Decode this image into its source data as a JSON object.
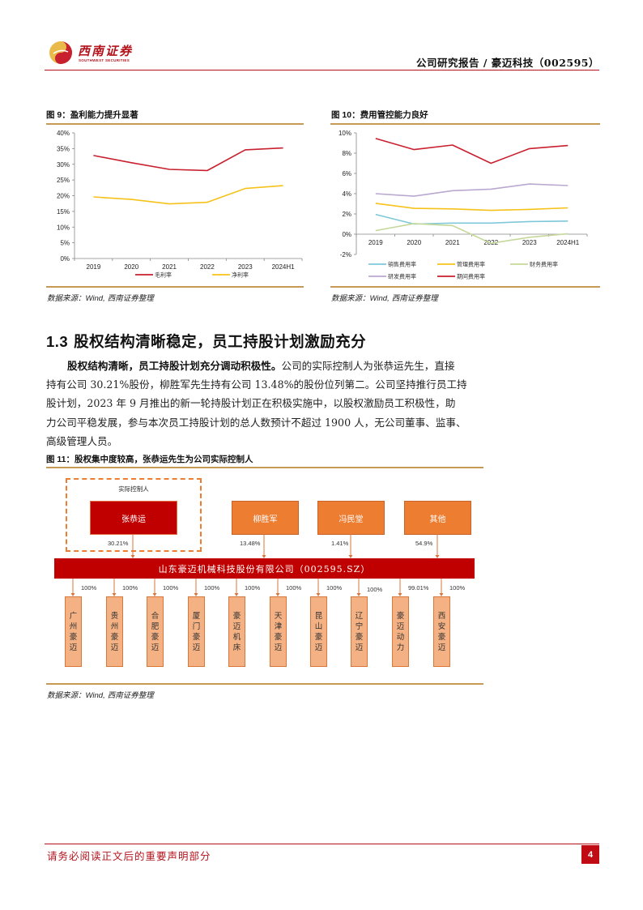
{
  "header": {
    "logo_cn": "西南证券",
    "logo_en": "SOUTHWEST SECURITIES",
    "title": "公司研究报告 / 豪迈科技（002595）",
    "brand_color": "#b3121b"
  },
  "figures": {
    "fig9": {
      "label": "图 9：",
      "title": "盈利能力提升显著",
      "source_prefix": "数据来源：",
      "source_en": "Wind,",
      "source_cn": " 西南证券整理"
    },
    "fig10": {
      "label": "图 10：",
      "title": "费用管控能力良好",
      "source_prefix": "数据来源：",
      "source_en": "Wind,",
      "source_cn": " 西南证券整理"
    },
    "fig11": {
      "label": "图 11：",
      "title": "股权集中度较高，张恭运先生为公司实际控制人",
      "source_prefix": "数据来源：",
      "source_en": "Wind,",
      "source_cn": " 西南证券整理"
    }
  },
  "chart_data": [
    {
      "id": "fig9",
      "type": "line",
      "title": "盈利能力提升显著",
      "categories": [
        "2019",
        "2020",
        "2021",
        "2022",
        "2023",
        "2024H1"
      ],
      "ylim": [
        0,
        40
      ],
      "yticks": [
        0,
        5,
        10,
        15,
        20,
        25,
        30,
        35,
        40
      ],
      "ytick_labels": [
        "0%",
        "5%",
        "10%",
        "15%",
        "20%",
        "25%",
        "30%",
        "35%",
        "40%"
      ],
      "grid": false,
      "legend": "bottom",
      "series": [
        {
          "name": "毛利率",
          "color": "#c8202e",
          "values": [
            32.8,
            30.5,
            28.4,
            28.0,
            34.6,
            35.2
          ]
        },
        {
          "name": "净利率",
          "color": "#f6c21a",
          "values": [
            19.6,
            18.8,
            17.4,
            17.9,
            22.3,
            23.2
          ]
        }
      ]
    },
    {
      "id": "fig10",
      "type": "line",
      "title": "费用管控能力良好",
      "categories": [
        "2019",
        "2020",
        "2021",
        "2022",
        "2023",
        "2024H1"
      ],
      "ylim": [
        -2,
        10
      ],
      "yticks": [
        -2,
        0,
        2,
        4,
        6,
        8,
        10
      ],
      "ytick_labels": [
        "-2%",
        "0%",
        "2%",
        "4%",
        "6%",
        "8%",
        "10%"
      ],
      "grid": false,
      "legend": "bottom",
      "series": [
        {
          "name": "销售费用率",
          "color": "#7fc8d8",
          "values": [
            1.95,
            1.0,
            1.1,
            1.1,
            1.25,
            1.3
          ]
        },
        {
          "name": "管理费用率",
          "color": "#f6c21a",
          "values": [
            3.05,
            2.55,
            2.5,
            2.35,
            2.45,
            2.6
          ]
        },
        {
          "name": "财务费用率",
          "color": "#c5d89a",
          "values": [
            0.35,
            1.05,
            0.85,
            -0.9,
            -0.3,
            0.05
          ]
        },
        {
          "name": "研发费用率",
          "color": "#b9a8d0",
          "values": [
            4.0,
            3.75,
            4.3,
            4.45,
            4.95,
            4.8
          ]
        },
        {
          "name": "期间费用率",
          "color": "#c8202e",
          "values": [
            9.45,
            8.35,
            8.8,
            7.0,
            8.45,
            8.75
          ]
        }
      ]
    }
  ],
  "section": {
    "number": "1.3",
    "title": " 股权结构清晰稳定，员工持股计划激励充分"
  },
  "paragraph": {
    "lines": [
      {
        "lead": "股权结构清晰，员工持股计划充分调动积极性。",
        "text": "公司的实际控制人为张恭运先生，直接"
      },
      {
        "lead": "",
        "text": "持有公司 30.21%股份，柳胜军先生持有公司 13.48%的股份位列第二。公司坚持推行员工持"
      },
      {
        "lead": "",
        "text": "股计划，2023 年 9 月推出的新一轮持股计划正在积极实施中，以股权激励员工积极性，助"
      },
      {
        "lead": "",
        "text": "力公司平稳发展，参与本次员工持股计划的总人数预计不超过 1900 人，无公司董事、监事、"
      },
      {
        "lead": "",
        "text": "高级管理人员。"
      }
    ]
  },
  "org_chart": {
    "controller_label": "实际控制人",
    "shareholders": [
      {
        "name": "张恭运",
        "pct": "30.21%",
        "controller": true
      },
      {
        "name": "柳胜军",
        "pct": "13.48%",
        "controller": false
      },
      {
        "name": "冯民堂",
        "pct": "1.41%",
        "controller": false
      },
      {
        "name": "其他",
        "pct": "54.9%",
        "controller": false
      }
    ],
    "company": "山东豪迈机械科技股份有限公司（002595.SZ）",
    "subsidiaries": [
      {
        "name": "广州豪迈",
        "pct": "100%"
      },
      {
        "name": "贵州豪迈",
        "pct": "100%"
      },
      {
        "name": "合肥豪迈",
        "pct": "100%"
      },
      {
        "name": "厦门豪迈",
        "pct": "100%"
      },
      {
        "name": "豪迈机床",
        "pct": "100%"
      },
      {
        "name": "天津豪迈",
        "pct": "100%"
      },
      {
        "name": "昆山豪迈",
        "pct": "100%"
      },
      {
        "name": "辽宁豪迈",
        "pct": "100%"
      },
      {
        "name": "豪迈动力",
        "pct": "99.01%"
      },
      {
        "name": "西安豪迈",
        "pct": "100%"
      }
    ],
    "colors": {
      "controller": "#c00000",
      "shareholder": "#ed7d31",
      "company": "#c00000",
      "subsidiary": "#f4b183",
      "connector": "#d9773a"
    }
  },
  "footer": {
    "disclaimer": "请务必阅读正文后的重要声明部分",
    "page_number": "4"
  }
}
